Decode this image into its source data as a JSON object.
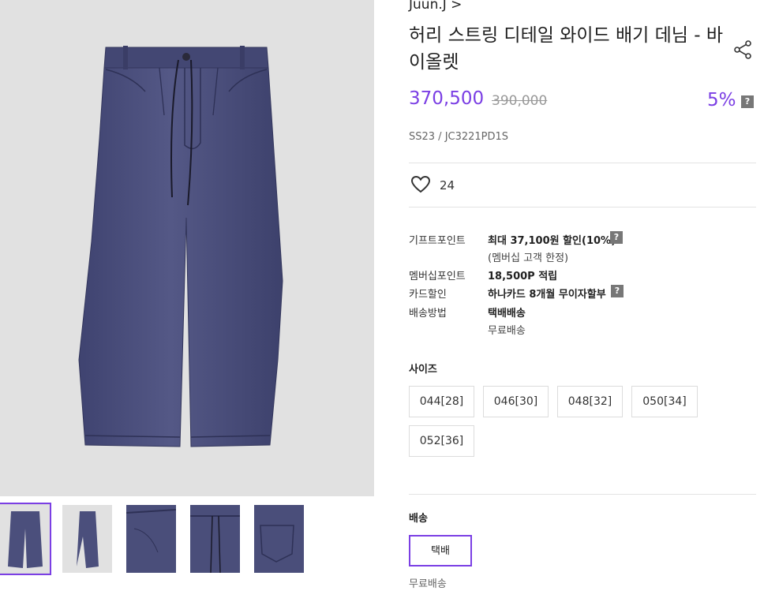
{
  "product": {
    "brand": "Juun.J >",
    "title": "허리 스트링 디테일 와이드 배기 데님 - 바이올렛",
    "sale_price": "370,500",
    "original_price": "390,000",
    "discount": "5%",
    "code": "SS23 / JC3221PD1S",
    "likes": "24"
  },
  "benefits": {
    "gift_point_label": "기프트포인트",
    "gift_point_value": "최대 37,100원 할인(10%)",
    "gift_point_note": "(멤버십 고객 한정)",
    "membership_label": "멤버십포인트",
    "membership_value": "18,500P 적립",
    "card_label": "카드할인",
    "card_value": "하나카드 8개월 무이자할부",
    "shipping_method_label": "배송방법",
    "shipping_method_value": "택배배송",
    "shipping_method_note": "무료배송"
  },
  "size": {
    "title": "사이즈",
    "options": [
      "044[28]",
      "046[30]",
      "048[32]",
      "050[34]",
      "052[36]"
    ]
  },
  "delivery": {
    "title": "배송",
    "option": "택배",
    "note": "무료배송"
  },
  "help_badge": "?",
  "icons": {
    "share": "share-icon",
    "like": "heart-icon",
    "help": "question-icon"
  },
  "colors": {
    "accent": "#7b3fe4",
    "denim": "#4b4f7c",
    "gallery_bg": "#e1e1e1"
  },
  "gallery": {
    "thumbnails": [
      "front",
      "side",
      "front-detail",
      "waist-detail",
      "back-detail"
    ],
    "active_index": 0
  }
}
